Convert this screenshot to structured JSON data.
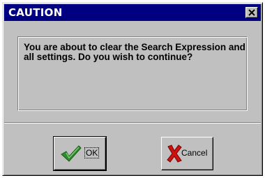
{
  "dialog": {
    "title": "CAUTION",
    "message": "You are about to clear the Search Expression and all settings.  Do you wish to continue?",
    "buttons": {
      "ok_label": "OK",
      "cancel_label": "Cancel"
    }
  },
  "icons": {
    "close": "close-icon",
    "ok": "checkmark-icon",
    "cancel": "red-x-icon"
  },
  "colors": {
    "title_bar": "#000080",
    "face": "#c0c0c0",
    "check_green": "#2e8b2e",
    "cancel_red": "#cc1111"
  }
}
